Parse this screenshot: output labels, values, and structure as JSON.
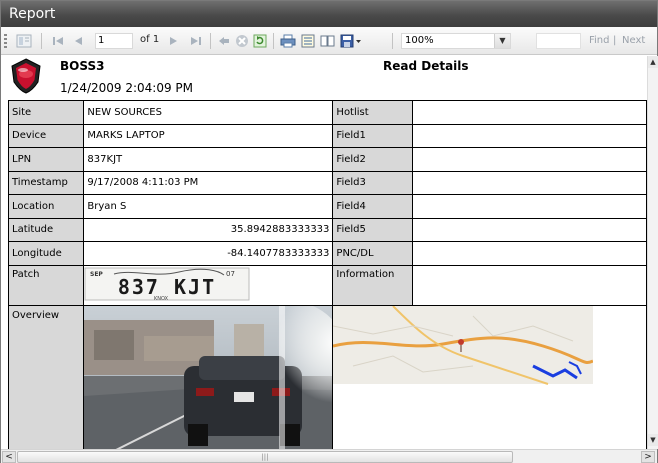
{
  "window": {
    "title": "Report"
  },
  "toolbar": {
    "current_page": "1",
    "of_pages": "of 1",
    "zoom": "100%",
    "find_label": "Find",
    "find_sep": "|",
    "next_label": "Next"
  },
  "report": {
    "name": "BOSS3",
    "title": "Read Details",
    "datetime": "1/24/2009 2:04:09 PM",
    "fields": {
      "site": {
        "label": "Site",
        "value": "NEW SOURCES"
      },
      "device": {
        "label": "Device",
        "value": "MARKS LAPTOP"
      },
      "lpn": {
        "label": "LPN",
        "value": "837KJT"
      },
      "timestamp": {
        "label": "Timestamp",
        "value": "9/17/2008 4:11:03 PM"
      },
      "location": {
        "label": "Location",
        "value": "Bryan S"
      },
      "latitude": {
        "label": "Latitude",
        "value": "35.8942883333333"
      },
      "longitude": {
        "label": "Longitude",
        "value": "-84.1407783333333"
      },
      "patch": {
        "label": "Patch"
      },
      "overview": {
        "label": "Overview"
      },
      "hotlist": {
        "label": "Hotlist"
      },
      "field1": {
        "label": "Field1"
      },
      "field2": {
        "label": "Field2"
      },
      "field3": {
        "label": "Field3"
      },
      "field4": {
        "label": "Field4"
      },
      "field5": {
        "label": "Field5"
      },
      "pnc_dl": {
        "label": "PNC/DL"
      },
      "information": {
        "label": "Information"
      }
    },
    "plate_text": "837 KJT",
    "plate_month": "SEP",
    "plate_year": "07",
    "plate_county": "KNOX"
  },
  "colors": {
    "label_bg": "#d8d8d8",
    "map_road": "#e9a040",
    "map_water": "#1a3ee0"
  }
}
